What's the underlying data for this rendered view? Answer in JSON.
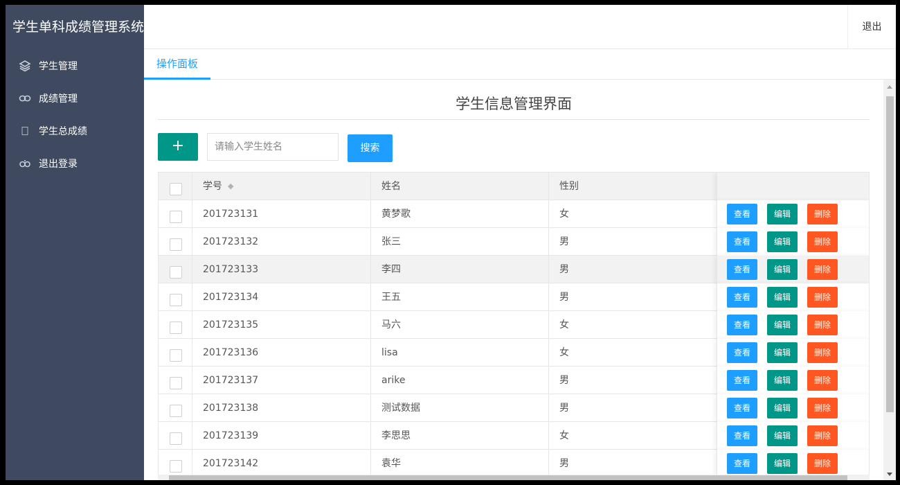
{
  "app": {
    "title": "学生单科成绩管理系统"
  },
  "sidebar": {
    "items": [
      {
        "label": "学生管理",
        "icon": "layers-icon"
      },
      {
        "label": "成绩管理",
        "icon": "link-icon"
      },
      {
        "label": "学生总成绩",
        "icon": "blank-icon"
      },
      {
        "label": "退出登录",
        "icon": "logout-icon"
      }
    ]
  },
  "header": {
    "logout_label": "退出"
  },
  "tabs": [
    {
      "label": "操作面板"
    }
  ],
  "main": {
    "title": "学生信息管理界面",
    "add_label": "+",
    "search_placeholder": "请输入学生姓名",
    "search_label": "搜索"
  },
  "table": {
    "columns": {
      "id": "学号",
      "name": "姓名",
      "sex": "性别"
    },
    "actions": {
      "view": "查看",
      "edit": "编辑",
      "delete": "删除"
    },
    "rows": [
      {
        "id": "201723131",
        "name": "黄梦歌",
        "sex": "女"
      },
      {
        "id": "201723132",
        "name": "张三",
        "sex": "男"
      },
      {
        "id": "201723133",
        "name": "李四",
        "sex": "男"
      },
      {
        "id": "201723134",
        "name": "王五",
        "sex": "男"
      },
      {
        "id": "201723135",
        "name": "马六",
        "sex": "女"
      },
      {
        "id": "201723136",
        "name": "lisa",
        "sex": "女"
      },
      {
        "id": "201723137",
        "name": "arike",
        "sex": "男"
      },
      {
        "id": "201723138",
        "name": "测试数据",
        "sex": "男"
      },
      {
        "id": "201723139",
        "name": "李思思",
        "sex": "女"
      },
      {
        "id": "201723142",
        "name": "袁华",
        "sex": "男"
      }
    ]
  },
  "colors": {
    "sidebar_bg": "#3f4a60",
    "primary_blue": "#1e9fff",
    "teal": "#009688",
    "danger_orange": "#ff5722"
  }
}
